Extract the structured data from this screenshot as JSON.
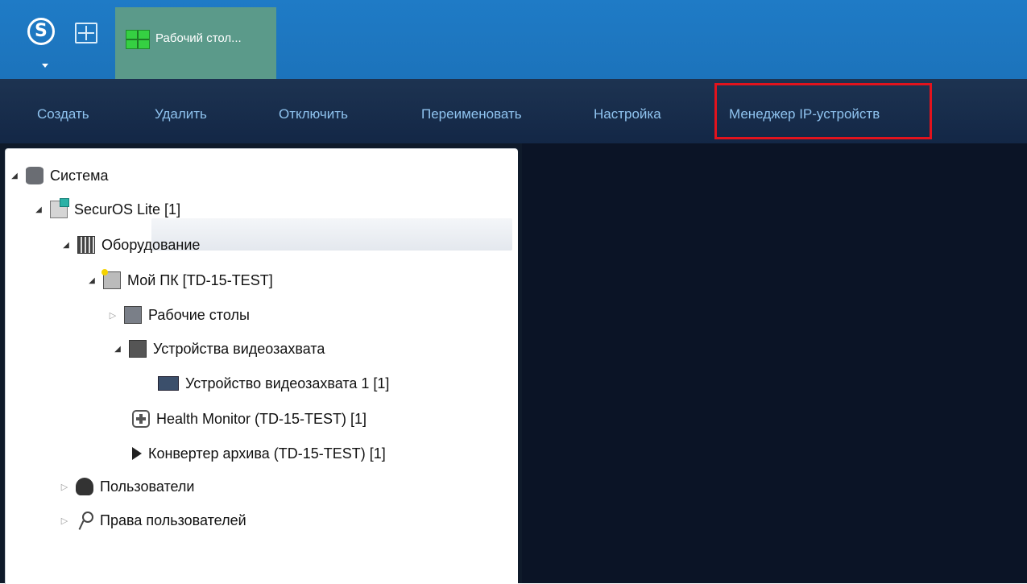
{
  "taskbar": {
    "logo_letter": "S",
    "active_tab_label": "Рабочий стол..."
  },
  "commands": [
    {
      "label": "Создать"
    },
    {
      "label": "Удалить"
    },
    {
      "label": "Отключить"
    },
    {
      "label": "Переименовать"
    },
    {
      "label": "Настройка"
    },
    {
      "label": "Менеджер IP-устройств"
    }
  ],
  "colors": {
    "taskbar": "#1c73bb",
    "command_bar": "#132746",
    "command_text": "#8fc3ef",
    "highlight": "#e2131d"
  },
  "tree": {
    "system": "Система",
    "server": "SecurOS Lite [1]",
    "hardware": "Оборудование",
    "my_pc": "Мой ПК [TD-15-TEST]",
    "desktops": "Рабочие столы",
    "capture_devices": "Устройства видеозахвата",
    "capture_device_1": "Устройство видеозахвата 1 [1]",
    "health_monitor": "Health Monitor (TD-15-TEST) [1]",
    "archive_converter": "Конвертер архива (TD-15-TEST) [1]",
    "users": "Пользователи",
    "user_rights": "Права пользователей"
  }
}
